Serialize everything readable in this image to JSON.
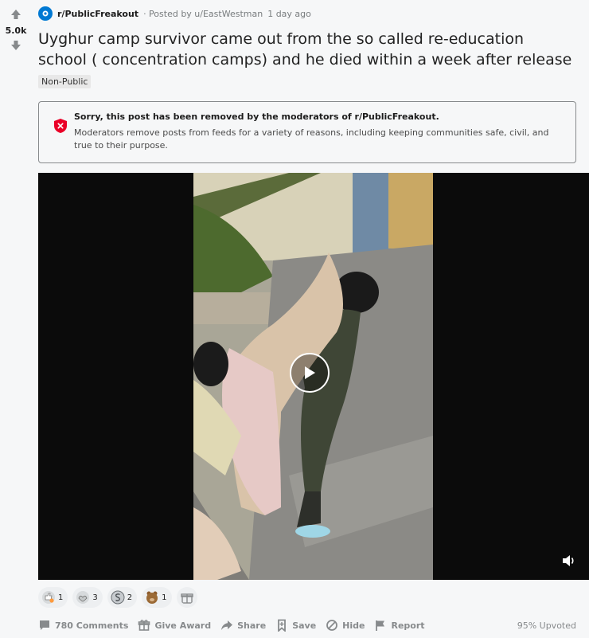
{
  "post": {
    "score": "5.0k",
    "subreddit": "r/PublicFreakout",
    "posted_by": "· Posted by u/EastWestman",
    "time": "1 day ago",
    "title": "Uyghur camp survivor came out from the so called re-education school ( concentration camps) and he died within a week after release",
    "flair": "Non-Public"
  },
  "removed_notice": {
    "heading": "Sorry, this post has been removed by the moderators of r/PublicFreakout.",
    "body": "Moderators remove posts from feeds for a variety of reasons, including keeping communities safe, civil, and true to their purpose."
  },
  "awards": [
    {
      "icon": "helpful-award-icon",
      "count": "1"
    },
    {
      "icon": "wholesome-award-icon",
      "count": "3"
    },
    {
      "icon": "silver-award-icon",
      "count": "2"
    },
    {
      "icon": "bear-award-icon",
      "count": "1"
    }
  ],
  "actions": {
    "comments": "780 Comments",
    "give_award": "Give Award",
    "share": "Share",
    "save": "Save",
    "hide": "Hide",
    "report": "Report",
    "upvoted": "95% Upvoted"
  },
  "colors": {
    "background": "#f6f7f8",
    "removed_icon": "#ea0027",
    "subreddit_icon": "#0079d3"
  }
}
